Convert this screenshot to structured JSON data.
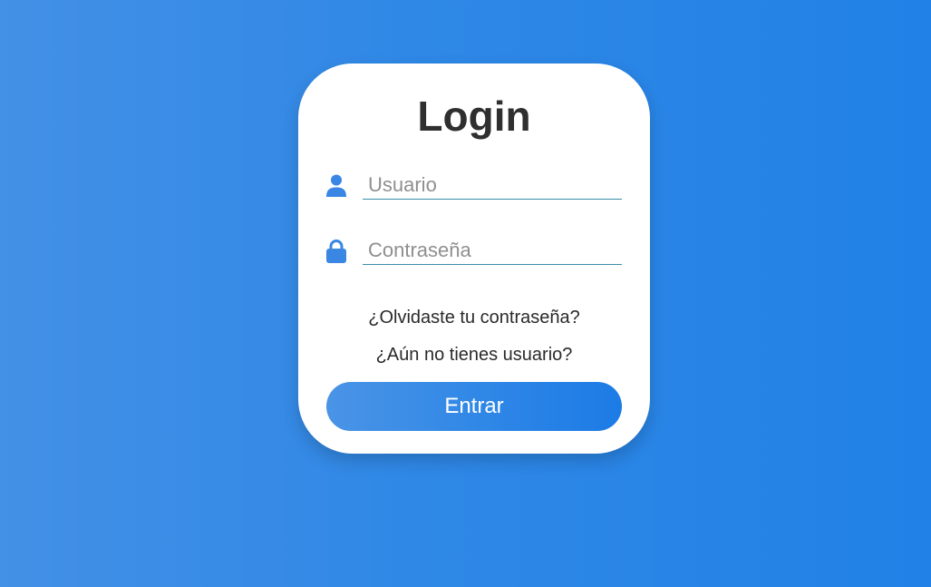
{
  "login": {
    "title": "Login",
    "username": {
      "icon": "user-icon",
      "placeholder": "Usuario",
      "value": ""
    },
    "password": {
      "icon": "lock-icon",
      "placeholder": "Contraseña",
      "value": ""
    },
    "forgot_link": "¿Olvidaste tu contraseña?",
    "register_link": "¿Aún no tienes usuario?",
    "submit_label": "Entrar"
  },
  "colors": {
    "accent": "#3a86e3",
    "background_start": "#4390e6",
    "background_end": "#2181e6",
    "card": "#ffffff",
    "title_text": "#2f2f2f"
  }
}
